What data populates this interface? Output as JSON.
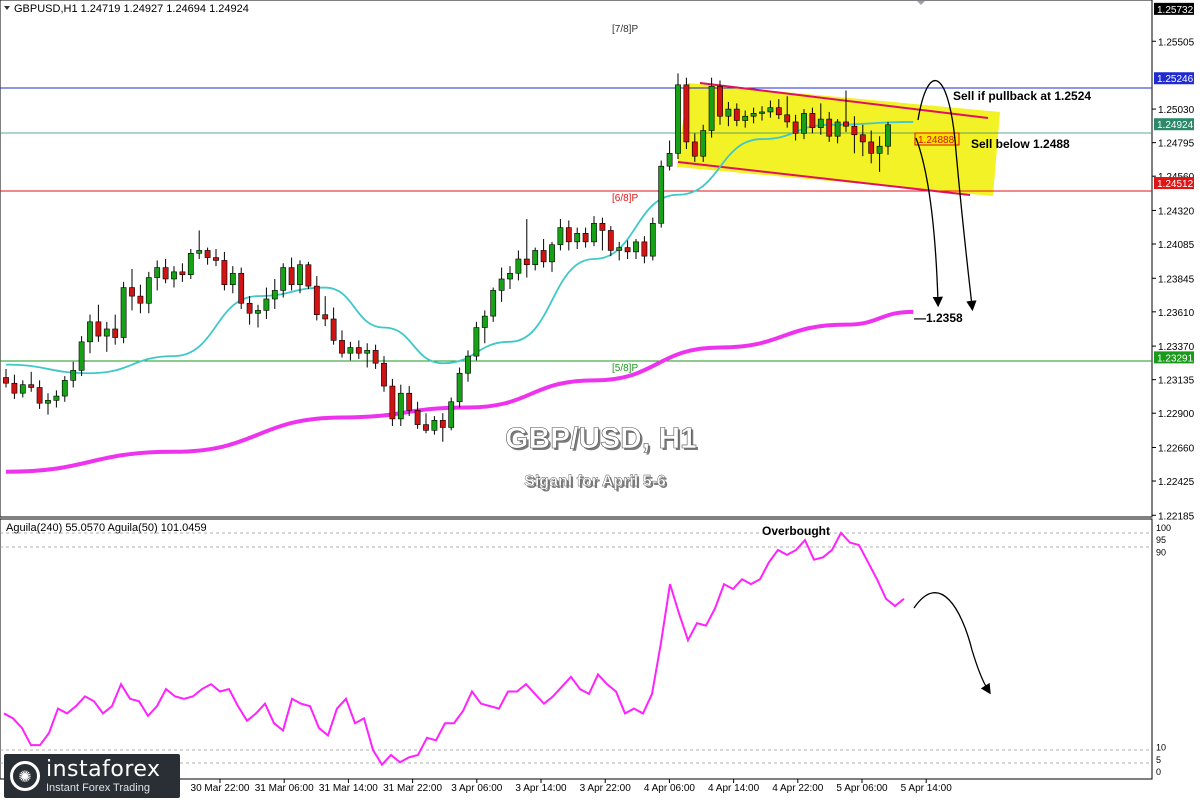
{
  "header": {
    "symbol_info": "GBPUSD,H1  1.24719 1.24927 1.24694 1.24924",
    "indicator_info": "Aguila(240) 55.0570  Aguila(50) 101.0459"
  },
  "overlay": {
    "title": "GBP/USD, H1",
    "subtitle": "Siganl for April 5-6",
    "sell_pullback_label": "Sell if pullback at 1.2524",
    "sell_below_label": "Sell below 1.2488",
    "target_label": "1.2358",
    "overbought_label": "Overbought",
    "murray_7_8": "[7/8]P",
    "murray_6_8": "[6/8]P",
    "murray_5_8": "[5/8]P",
    "price_box_label": "1.24888"
  },
  "colors": {
    "bull": "#16a116",
    "bear": "#d01313",
    "ema_fast": "#40c8c8",
    "ema_slow": "#ee33ee",
    "oscillator": "#ff22ff",
    "channel_fill": "#f0f000",
    "channel_line": "#e01060",
    "line_7_8": "#1f2bd0",
    "line_6_8": "#e01515",
    "line_5_8": "#1a9a1a",
    "current_line": "#2c8a6a"
  },
  "chart_data": [
    {
      "type": "candlestick",
      "title": "GBP/USD, H1",
      "symbol": "GBPUSD",
      "timeframe": "H1",
      "ylim": [
        1.2218,
        1.2578
      ],
      "y_ticks": [
        "1.25505",
        "1.25030",
        "1.24795",
        "1.24560",
        "1.24320",
        "1.24085",
        "1.23845",
        "1.23610",
        "1.23370",
        "1.23135",
        "1.22900",
        "1.22660",
        "1.22425",
        "1.22185"
      ],
      "x_ticks": [
        "30 Mar 22:00",
        "31 Mar 06:00",
        "31 Mar 14:00",
        "31 Mar 22:00",
        "3 Apr 06:00",
        "3 Apr 14:00",
        "3 Apr 22:00",
        "4 Apr 06:00",
        "4 Apr 14:00",
        "4 Apr 22:00",
        "5 Apr 06:00",
        "5 Apr 14:00"
      ],
      "price_levels": [
        {
          "name": "[7/8]P",
          "value": "1.25246",
          "color": "#1f2bd0"
        },
        {
          "name": "current",
          "value": "1.24924",
          "color": "#2c8a6a"
        },
        {
          "name": "[6/8]P",
          "value": "1.24512",
          "color": "#e01515"
        },
        {
          "name": "[5/8]P",
          "value": "1.23291",
          "color": "#1a9a1a"
        }
      ],
      "top_level_label": "1.25732",
      "candles": [
        [
          1.2315,
          1.2321,
          1.2308,
          1.2311
        ],
        [
          1.2311,
          1.2317,
          1.23,
          1.2304
        ],
        [
          1.2304,
          1.2313,
          1.2301,
          1.231
        ],
        [
          1.231,
          1.2319,
          1.2305,
          1.2308
        ],
        [
          1.2308,
          1.2313,
          1.2293,
          1.2297
        ],
        [
          1.2297,
          1.2304,
          1.2289,
          1.2299
        ],
        [
          1.2299,
          1.2306,
          1.2294,
          1.2302
        ],
        [
          1.2302,
          1.2316,
          1.2298,
          1.2313
        ],
        [
          1.2313,
          1.2326,
          1.2308,
          1.232
        ],
        [
          1.232,
          1.2344,
          1.2316,
          1.234
        ],
        [
          1.234,
          1.2359,
          1.2332,
          1.2354
        ],
        [
          1.2354,
          1.2366,
          1.234,
          1.2344
        ],
        [
          1.2344,
          1.2354,
          1.2333,
          1.2349
        ],
        [
          1.2349,
          1.2359,
          1.2338,
          1.2343
        ],
        [
          1.2343,
          1.2382,
          1.2339,
          1.2378
        ],
        [
          1.2378,
          1.2391,
          1.2362,
          1.2372
        ],
        [
          1.2372,
          1.238,
          1.236,
          1.2367
        ],
        [
          1.2367,
          1.2389,
          1.236,
          1.2385
        ],
        [
          1.2385,
          1.2397,
          1.2376,
          1.2392
        ],
        [
          1.2392,
          1.2398,
          1.2381,
          1.2384
        ],
        [
          1.2384,
          1.2393,
          1.2378,
          1.2389
        ],
        [
          1.2389,
          1.2395,
          1.2382,
          1.2387
        ],
        [
          1.2387,
          1.2405,
          1.2384,
          1.2402
        ],
        [
          1.2402,
          1.2418,
          1.2398,
          1.2404
        ],
        [
          1.2404,
          1.2406,
          1.2394,
          1.2399
        ],
        [
          1.2399,
          1.2405,
          1.2393,
          1.2397
        ],
        [
          1.2397,
          1.2403,
          1.2376,
          1.238
        ],
        [
          1.238,
          1.2393,
          1.2374,
          1.2388
        ],
        [
          1.2388,
          1.2392,
          1.2363,
          1.2367
        ],
        [
          1.2367,
          1.2372,
          1.2352,
          1.236
        ],
        [
          1.236,
          1.2366,
          1.235,
          1.2362
        ],
        [
          1.2362,
          1.2378,
          1.2356,
          1.237
        ],
        [
          1.237,
          1.2384,
          1.2363,
          1.2376
        ],
        [
          1.2376,
          1.2395,
          1.2371,
          1.2392
        ],
        [
          1.2392,
          1.2399,
          1.2376,
          1.238
        ],
        [
          1.238,
          1.2397,
          1.2374,
          1.2394
        ],
        [
          1.2394,
          1.2396,
          1.2377,
          1.2379
        ],
        [
          1.2379,
          1.2386,
          1.2355,
          1.2359
        ],
        [
          1.2359,
          1.2372,
          1.2351,
          1.2356
        ],
        [
          1.2356,
          1.2364,
          1.2338,
          1.2341
        ],
        [
          1.2341,
          1.2348,
          1.2329,
          1.2332
        ],
        [
          1.2332,
          1.234,
          1.2327,
          1.2336
        ],
        [
          1.2336,
          1.2341,
          1.2328,
          1.2332
        ],
        [
          1.2332,
          1.2339,
          1.2322,
          1.2334
        ],
        [
          1.2334,
          1.2338,
          1.2321,
          1.2325
        ],
        [
          1.2325,
          1.233,
          1.2305,
          1.2309
        ],
        [
          1.2309,
          1.2314,
          1.2281,
          1.2286
        ],
        [
          1.2286,
          1.231,
          1.2281,
          1.2304
        ],
        [
          1.2304,
          1.2309,
          1.2288,
          1.2292
        ],
        [
          1.2292,
          1.2298,
          1.2279,
          1.2282
        ],
        [
          1.2282,
          1.229,
          1.2276,
          1.2278
        ],
        [
          1.2278,
          1.2288,
          1.2275,
          1.2285
        ],
        [
          1.2285,
          1.229,
          1.227,
          1.228
        ],
        [
          1.228,
          1.2301,
          1.2278,
          1.2298
        ],
        [
          1.2298,
          1.2322,
          1.2294,
          1.2318
        ],
        [
          1.2318,
          1.2334,
          1.2312,
          1.233
        ],
        [
          1.233,
          1.2354,
          1.2327,
          1.235
        ],
        [
          1.235,
          1.2362,
          1.2339,
          1.2358
        ],
        [
          1.2358,
          1.2378,
          1.2354,
          1.2376
        ],
        [
          1.2376,
          1.2392,
          1.2368,
          1.2384
        ],
        [
          1.2384,
          1.2393,
          1.2377,
          1.2388
        ],
        [
          1.2388,
          1.2404,
          1.2383,
          1.2398
        ],
        [
          1.2398,
          1.2426,
          1.2385,
          1.2394
        ],
        [
          1.2394,
          1.2406,
          1.239,
          1.2404
        ],
        [
          1.2404,
          1.2412,
          1.2392,
          1.2396
        ],
        [
          1.2396,
          1.241,
          1.2389,
          1.2408
        ],
        [
          1.2408,
          1.2426,
          1.2404,
          1.242
        ],
        [
          1.242,
          1.2425,
          1.2404,
          1.241
        ],
        [
          1.241,
          1.242,
          1.2405,
          1.2416
        ],
        [
          1.2416,
          1.242,
          1.2406,
          1.241
        ],
        [
          1.241,
          1.2428,
          1.2407,
          1.2423
        ],
        [
          1.2423,
          1.2427,
          1.2404,
          1.2418
        ],
        [
          1.2418,
          1.2421,
          1.24,
          1.2404
        ],
        [
          1.2404,
          1.241,
          1.2397,
          1.2406
        ],
        [
          1.2406,
          1.2411,
          1.2398,
          1.2403
        ],
        [
          1.2403,
          1.2412,
          1.2398,
          1.241
        ],
        [
          1.241,
          1.2414,
          1.2395,
          1.24
        ],
        [
          1.24,
          1.2427,
          1.2397,
          1.2423
        ],
        [
          1.2423,
          1.2467,
          1.242,
          1.2463
        ],
        [
          1.2463,
          1.2481,
          1.246,
          1.2472
        ],
        [
          1.2472,
          1.2528,
          1.2468,
          1.252
        ],
        [
          1.252,
          1.2525,
          1.2475,
          1.248
        ],
        [
          1.248,
          1.2486,
          1.2466,
          1.247
        ],
        [
          1.247,
          1.2492,
          1.2466,
          1.2488
        ],
        [
          1.2488,
          1.2525,
          1.2483,
          1.2519
        ],
        [
          1.2519,
          1.2523,
          1.2492,
          1.2498
        ],
        [
          1.2498,
          1.2508,
          1.2491,
          1.2503
        ],
        [
          1.2503,
          1.2507,
          1.2491,
          1.2495
        ],
        [
          1.2495,
          1.2502,
          1.249,
          1.2498
        ],
        [
          1.2498,
          1.2504,
          1.2493,
          1.25
        ],
        [
          1.25,
          1.2505,
          1.2495,
          1.2501
        ],
        [
          1.2501,
          1.2509,
          1.2497,
          1.2504
        ],
        [
          1.2504,
          1.251,
          1.2496,
          1.2499
        ],
        [
          1.2499,
          1.2512,
          1.249,
          1.2494
        ],
        [
          1.2494,
          1.2499,
          1.2481,
          1.2486
        ],
        [
          1.2486,
          1.2503,
          1.2482,
          1.25
        ],
        [
          1.25,
          1.2504,
          1.2486,
          1.249
        ],
        [
          1.249,
          1.2507,
          1.2485,
          1.2496
        ],
        [
          1.2496,
          1.2501,
          1.248,
          1.2484
        ],
        [
          1.2484,
          1.2496,
          1.2479,
          1.2494
        ],
        [
          1.2494,
          1.2516,
          1.2487,
          1.2491
        ],
        [
          1.2491,
          1.2498,
          1.2472,
          1.2485
        ],
        [
          1.2485,
          1.2492,
          1.247,
          1.248
        ],
        [
          1.248,
          1.2488,
          1.2465,
          1.2472
        ],
        [
          1.2472,
          1.2484,
          1.2459,
          1.2477
        ],
        [
          1.2477,
          1.2494,
          1.2471,
          1.2492
        ]
      ],
      "ema_fast": {
        "label": "EMA (cyan)",
        "points": [
          [
            0,
            1.2324
          ],
          [
            10,
            1.2318
          ],
          [
            20,
            1.233
          ],
          [
            30,
            1.2372
          ],
          [
            38,
            1.2378
          ],
          [
            45,
            1.235
          ],
          [
            52,
            1.2325
          ],
          [
            60,
            1.234
          ],
          [
            70,
            1.2398
          ],
          [
            80,
            1.2443
          ],
          [
            90,
            1.2482
          ],
          [
            98,
            1.2492
          ],
          [
            108,
            1.2494
          ]
        ]
      },
      "ema_slow": {
        "label": "EMA (magenta)",
        "points": [
          [
            0,
            1.2249
          ],
          [
            20,
            1.2263
          ],
          [
            40,
            1.2287
          ],
          [
            55,
            1.2294
          ],
          [
            70,
            1.2313
          ],
          [
            85,
            1.2336
          ],
          [
            100,
            1.2352
          ],
          [
            108,
            1.2361
          ]
        ]
      }
    },
    {
      "type": "line",
      "title": "Aguila",
      "ylim": [
        0,
        100
      ],
      "y_ticks": [
        "100",
        "95",
        "90",
        "10",
        "5",
        "0"
      ],
      "series": [
        {
          "name": "Aguila(50)",
          "values": [
            24,
            22,
            18,
            11,
            11,
            16,
            26,
            24,
            27,
            31,
            29,
            24,
            27,
            36,
            30,
            29,
            23,
            27,
            34,
            31,
            30,
            31,
            34,
            36,
            33,
            34,
            27,
            21,
            24,
            28,
            20,
            17,
            30,
            28,
            27,
            18,
            15,
            26,
            30,
            20,
            22,
            9,
            3,
            7,
            4,
            6,
            7,
            14,
            13,
            20,
            20,
            25,
            33,
            28,
            27,
            26,
            33,
            33,
            36,
            32,
            28,
            31,
            35,
            39,
            34,
            32,
            40,
            36,
            33,
            24,
            26,
            24,
            32,
            53,
            77,
            65,
            54,
            61,
            60,
            67,
            77,
            75,
            79,
            77,
            79,
            86,
            91,
            89,
            91,
            95,
            87,
            88,
            91,
            98,
            94,
            93,
            86,
            79,
            71,
            68,
            71
          ]
        }
      ],
      "annotations": [
        "Overbought"
      ]
    }
  ]
}
